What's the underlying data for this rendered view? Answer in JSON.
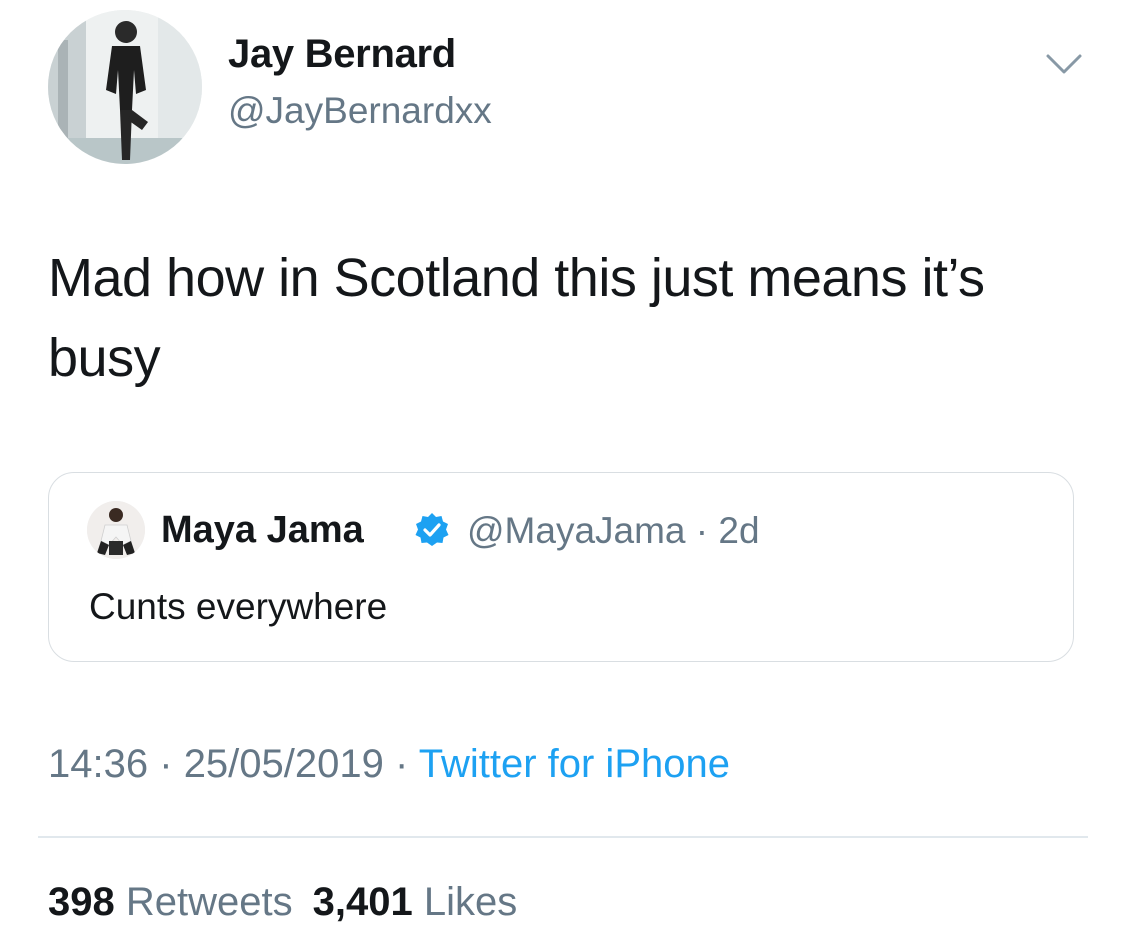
{
  "tweet": {
    "author": {
      "display_name": "Jay Bernard",
      "handle": "@JayBernardxx",
      "avatar_icon": "person-standing-photo-icon"
    },
    "menu_icon": "chevron-down-icon",
    "text": "Mad how in Scotland this just means it’s busy",
    "quoted_tweet": {
      "display_name": "Maya Jama",
      "verified": true,
      "verified_icon": "verified-badge-icon",
      "handle": "@MayaJama",
      "separator": "·",
      "age": "2d",
      "text": "Cunts everywhere"
    },
    "time": "14:36",
    "date": "25/05/2019",
    "separator": "·",
    "source": "Twitter for iPhone",
    "retweets_count": "398",
    "retweets_label": "Retweets",
    "likes_count": "3,401",
    "likes_label": "Likes"
  },
  "colors": {
    "text_primary": "#14171a",
    "text_secondary": "#657786",
    "link": "#1da1f2",
    "verified": "#1da1f2",
    "border": "#e1e8ed"
  }
}
